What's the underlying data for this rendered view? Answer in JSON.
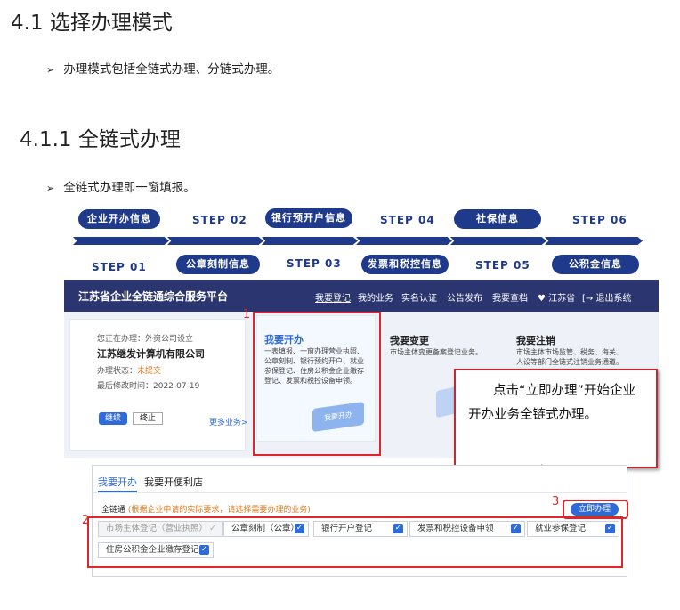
{
  "headings": {
    "h41": "4.1 选择办理模式",
    "bullet1": "办理模式包括全链式办理、分链式办理。",
    "h411": "4.1.1 全链式办理",
    "bullet2": "全链式办理即一窗填报。",
    "bullet_mark": "➢"
  },
  "steps": {
    "top": [
      {
        "kind": "pill",
        "label": "企业开办信息"
      },
      {
        "kind": "step",
        "label": "STEP 02"
      },
      {
        "kind": "pill",
        "label": "银行预开户信息"
      },
      {
        "kind": "step",
        "label": "STEP 04"
      },
      {
        "kind": "pill",
        "label": "社保信息"
      },
      {
        "kind": "step",
        "label": "STEP 06"
      }
    ],
    "bottom": [
      {
        "kind": "step",
        "label": "STEP 01"
      },
      {
        "kind": "pill",
        "label": "公章刻制信息"
      },
      {
        "kind": "step",
        "label": "STEP 03"
      },
      {
        "kind": "pill",
        "label": "发票和税控信息"
      },
      {
        "kind": "step",
        "label": "STEP 05"
      },
      {
        "kind": "pill",
        "label": "公积金信息"
      }
    ]
  },
  "platform": {
    "title": "江苏省企业全链通综合服务平台",
    "nav": [
      "我要登记",
      "我的业务",
      "实名认证",
      "公告发布",
      "我要查档",
      "♥ 江苏省",
      "[→ 退出系统"
    ],
    "current": {
      "line1": "您正在办理：外资公司设立",
      "company": "江苏继发计算机有限公司",
      "status_label": "办理状态：",
      "status_value": "未提交",
      "modified": "最后修改时间：2022-07-19",
      "continue_btn": "继续",
      "stop_btn": "终止",
      "more": "更多业务>"
    },
    "card1": {
      "title": "我要开办",
      "desc": "一表填报、一窗办理营业执照、公章刻制、银行预约开户、就业参保登记、住房公积金企业缴存登记、发票和税控设备申领。",
      "illus": "我要开办"
    },
    "card2": {
      "title": "我要变更",
      "desc": "市场主体变更备案登记业务。"
    },
    "card3": {
      "title": "我要注销",
      "desc": "市场主体市场监管、税务、海关、人设等部门全链式注销业务通道。"
    }
  },
  "callout": {
    "text": "点击“立即办理”开始企业开办业务全链式办理。"
  },
  "markers": {
    "m1": "1",
    "m2": "2",
    "m3": "3"
  },
  "panel": {
    "tabs": [
      "我要开办",
      "我要开便利店"
    ],
    "label": "全链通",
    "hint": "(根据企业申请的实际要求，请选择需要办理的业务)",
    "submit": "立即办理",
    "options": [
      {
        "label": "市场主体登记（营业执照）",
        "checked": "gray"
      },
      {
        "label": "公章刻制（公章）",
        "checked": "blue"
      },
      {
        "label": "银行开户登记",
        "checked": "blue"
      },
      {
        "label": "发票和税控设备申领",
        "checked": "blue"
      },
      {
        "label": "就业参保登记",
        "checked": "blue"
      },
      {
        "label": "住房公积金企业缴存登记",
        "checked": "blue"
      }
    ],
    "check_glyph": "✓"
  },
  "colors": {
    "navy": "#1f3a8a",
    "bar": "#2b3670",
    "red": "#e0262b",
    "blue": "#2f6bd8"
  }
}
